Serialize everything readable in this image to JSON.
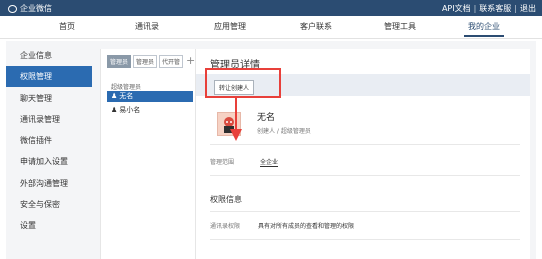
{
  "topbar": {
    "app_name": "企业微信",
    "links": [
      "API文档",
      "联系客服",
      "退出"
    ]
  },
  "nav": {
    "items": [
      "首页",
      "通讯录",
      "应用管理",
      "客户联系",
      "管理工具",
      "我的企业"
    ],
    "active_index": 5
  },
  "sidebar": {
    "items": [
      "企业信息",
      "权限管理",
      "聊天管理",
      "通讯录管理",
      "微信插件",
      "申请加入设置",
      "外部沟通管理",
      "安全与保密",
      "设置"
    ],
    "active_index": 1
  },
  "admins": {
    "filters": [
      "管理员",
      "管理员",
      "代开管"
    ],
    "active_filter": 0,
    "plus": "+",
    "group_title": "超级管理员",
    "members": [
      "无名",
      "易小名"
    ],
    "selected_member": 0
  },
  "detail": {
    "title": "管理员详情",
    "transfer_button": "转让创建人",
    "name": "无名",
    "role": "创建人 / 超级管理员",
    "scope_label": "管理范围",
    "scope_value": "全企业",
    "permission_section": "权限信息",
    "perm_label": "通讯录权限",
    "perm_value": "具有对所有成员的查看和管理的权限"
  },
  "colors": {
    "topbar": "#2b4c72",
    "active_blue": "#2b6bb1",
    "highlight_red": "#e8403a"
  }
}
